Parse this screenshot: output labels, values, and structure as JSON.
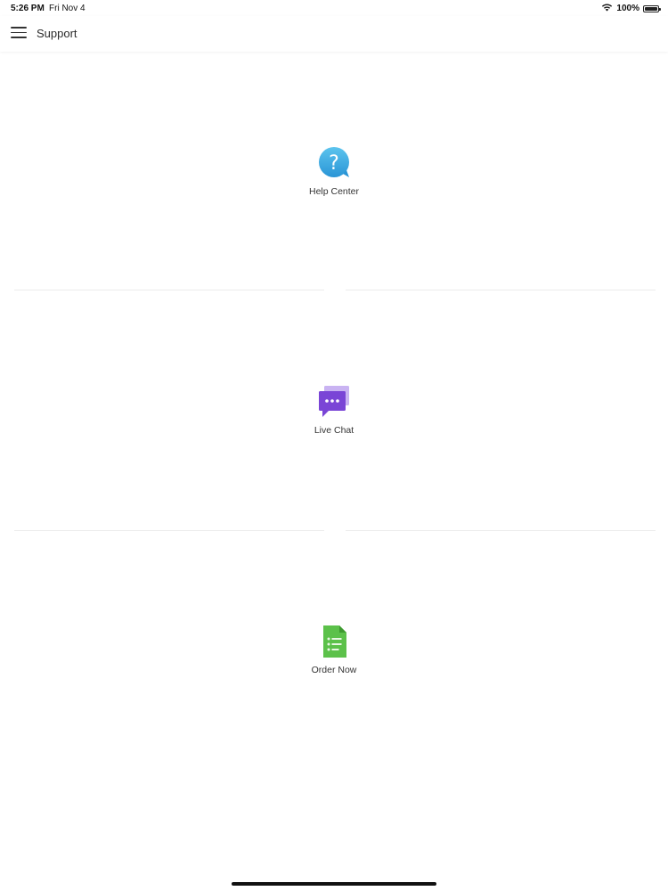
{
  "status_bar": {
    "time": "5:26 PM",
    "date": "Fri Nov 4",
    "battery": "100%",
    "battery_level": 1.0,
    "wifi_icon": "wifi-icon",
    "battery_icon": "battery-icon"
  },
  "nav": {
    "title": "Support",
    "menu_icon": "hamburger-menu-icon"
  },
  "tiles": [
    {
      "label": "Help Center",
      "icon": "question-bubble-icon",
      "color": "#3aa8e0"
    },
    {
      "label": "Live Chat",
      "icon": "chat-bubbles-icon",
      "color": "#7a45d6"
    },
    {
      "label": "Order Now",
      "icon": "order-document-icon",
      "color": "#5cc14a"
    }
  ]
}
